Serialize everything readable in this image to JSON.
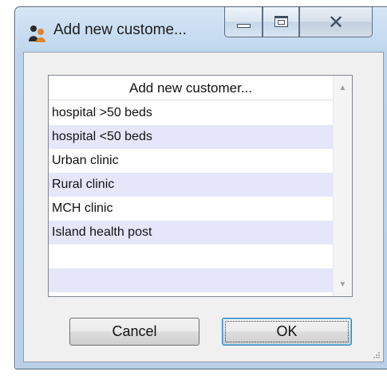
{
  "window": {
    "title": "Add new custome...",
    "app_icon": "users-icon",
    "controls": [
      "minimize-icon",
      "maximize-icon",
      "close-icon"
    ]
  },
  "list": {
    "header": "Add new customer...",
    "items": [
      {
        "label": "hospital >50 beds"
      },
      {
        "label": "hospital <50 beds"
      },
      {
        "label": "Urban clinic"
      },
      {
        "label": "Rural clinic"
      },
      {
        "label": "MCH clinic"
      },
      {
        "label": "Island health post"
      },
      {
        "label": ""
      },
      {
        "label": ""
      }
    ]
  },
  "buttons": {
    "cancel_label": "Cancel",
    "ok_label": "OK"
  },
  "colors": {
    "row_alt": "#e6e6fa",
    "frame": "#c3d9ef"
  }
}
